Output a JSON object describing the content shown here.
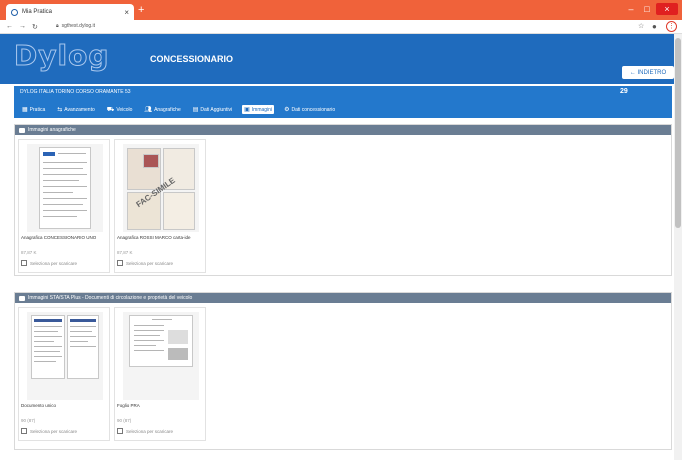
{
  "browser": {
    "tab_title": "Mia Pratica",
    "tab_close": "×",
    "new_tab": "+",
    "url": "sgthest.dylog.it",
    "win_min": "‒",
    "win_max": "□",
    "win_close": "×"
  },
  "app": {
    "logo": "Dylog",
    "title": "CONCESSIONARIO",
    "back_label": "← INDIETRO"
  },
  "subheader": {
    "title": "DYLOG ITALIA TORINO CORSO ORAMANTE 53",
    "count": "29",
    "tabs": [
      {
        "label": "Pratica",
        "icon": "grid-icon"
      },
      {
        "label": "Avanzamento",
        "icon": "progress-icon"
      },
      {
        "label": "Veicolo",
        "icon": "car-icon"
      },
      {
        "label": "Anagrafiche",
        "icon": "users-icon"
      },
      {
        "label": "Dati Aggiuntivi",
        "icon": "list-icon"
      },
      {
        "label": "Immagini",
        "icon": "image-icon"
      },
      {
        "label": "Dati concessionario",
        "icon": "gear-icon"
      }
    ]
  },
  "sections": [
    {
      "title": "Immagini anagrafiche",
      "cards": [
        {
          "name": "Anagrafica CONCESSIONARIO UNO",
          "size": "87,87 K",
          "check_label": "Seleziona per scaricare"
        },
        {
          "name": "Anagrafica ROSSI MARCO carta-ide",
          "size": "87,87 K",
          "check_label": "Seleziona per scaricare"
        }
      ]
    },
    {
      "title": "Immagini STA/STA Plus - Documenti di circolazione e proprietà del veicolo",
      "cards": [
        {
          "name": "Documento unico",
          "size": "90 (87)",
          "check_label": "Seleziona per scaricare"
        },
        {
          "name": "Foglio PRA",
          "size": "90 (87)",
          "check_label": "Seleziona per scaricare"
        }
      ]
    }
  ]
}
